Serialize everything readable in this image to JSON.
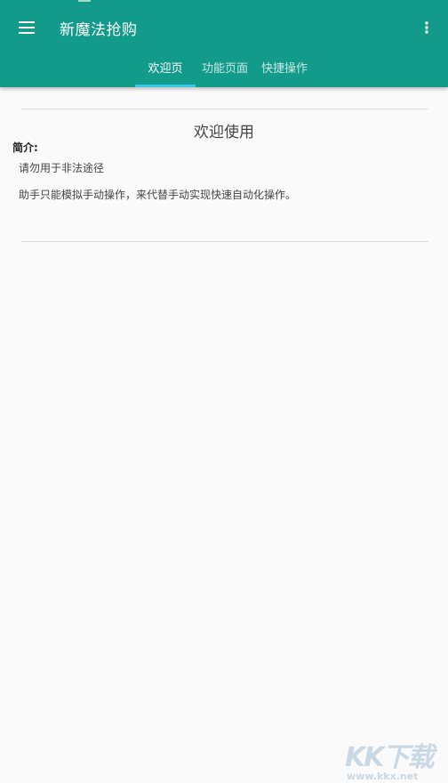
{
  "app": {
    "title": "新魔法抢购"
  },
  "toolbar": {
    "menu_icon": "hamburger-menu-icon",
    "more_icon": "more-vert-icon"
  },
  "tabs": [
    {
      "label": "欢迎页",
      "active": true
    },
    {
      "label": "功能页面",
      "active": false
    },
    {
      "label": "快捷操作",
      "active": false
    }
  ],
  "colors": {
    "primary": "#129a8a",
    "indicator": "#35c6e8",
    "background": "#fafafa"
  },
  "content": {
    "title": "欢迎使用",
    "intro_label": "简介:",
    "lines": [
      "请勿用于非法途径",
      "助手只能模拟手动操作，来代替手动实现快速自动化操作。"
    ]
  },
  "watermark": {
    "logo": "KK下载",
    "url": "www.kkx.net"
  }
}
